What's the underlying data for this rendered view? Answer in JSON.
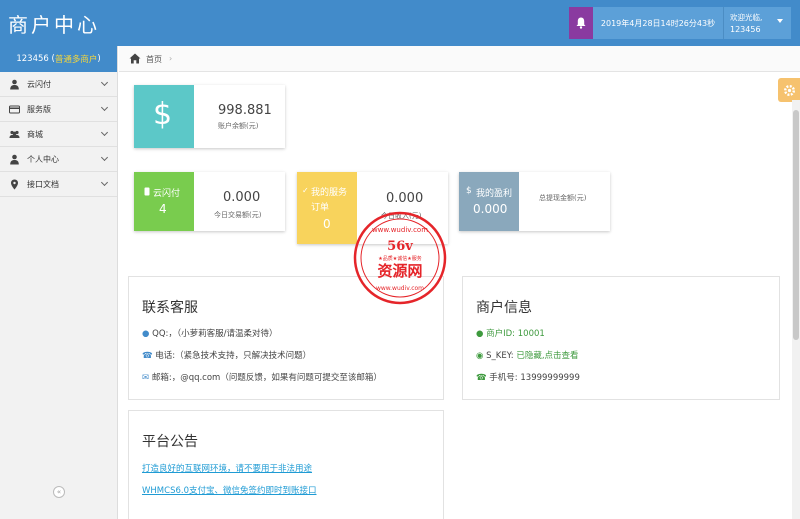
{
  "header": {
    "logo": "商户中心",
    "datetime": "2019年4月28日14时26分43秒",
    "welcome": "欢迎光临,",
    "username": "123456"
  },
  "sidebar": {
    "user_id": "123456 (",
    "user_level": "普通多商户",
    "user_close": ")",
    "items": [
      {
        "label": "云闪付",
        "icon": "user-icon"
      },
      {
        "label": "服务版",
        "icon": "card-icon"
      },
      {
        "label": "商城",
        "icon": "users-icon"
      },
      {
        "label": "个人中心",
        "icon": "user-icon"
      },
      {
        "label": "接口文档",
        "icon": "map-marker-icon"
      }
    ],
    "collapse_label": "«"
  },
  "breadcrumb": {
    "home": "首页",
    "sep": "›"
  },
  "balance_card": {
    "symbol": "$",
    "amount": "998.881",
    "label": "账户余额(元)",
    "color": "#5cc8c8"
  },
  "stats": [
    {
      "title": "云闪付",
      "count": "4",
      "amount": "0.000",
      "label": "今日交易额(元)",
      "color": "#79cc4e"
    },
    {
      "title": "我的服务订单",
      "count": "0",
      "amount": "0.000",
      "label": "今日收入(元)",
      "color": "#f8d35c"
    },
    {
      "title": "我的盈利",
      "count": "0.000",
      "amount": "",
      "label": "总提现金额(元)",
      "color": "#8aa8bc"
    }
  ],
  "contact": {
    "title": "联系客服",
    "qq": "QQ:，（小萝莉客服/请温柔对待）",
    "phone": "电话:（紧急技术支持，只解决技术问题）",
    "email": "邮箱:，@qq.com（问题反馈，如果有问题可提交至该邮箱）"
  },
  "merchant": {
    "title": "商户信息",
    "id_label": "商户ID:",
    "id_value": "10001",
    "skey_label": "S_KEY:",
    "skey_value": "已隐藏,点击查看",
    "phone_label": "手机号:",
    "phone_value": "13999999999"
  },
  "notice": {
    "title": "平台公告",
    "links": [
      "打造良好的互联网环境，请不要用于非法用途",
      "WHMCS6.0支付宝、微信免签约即时到账接口"
    ]
  },
  "watermark": {
    "brand": "56v",
    "name": "资源网",
    "url": "www.wudiv.com",
    "slogan": "★品质★诚信★服务"
  }
}
